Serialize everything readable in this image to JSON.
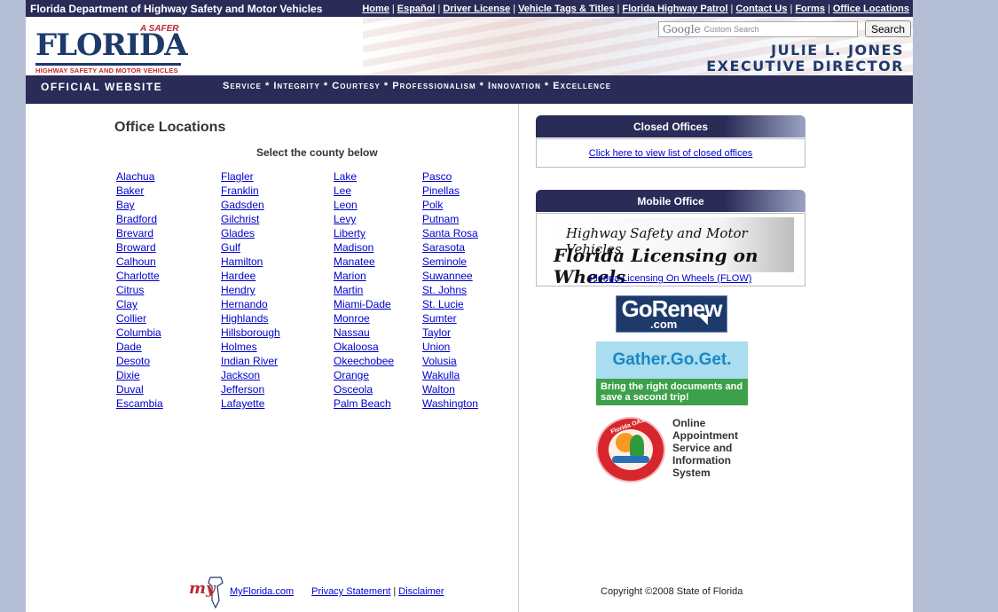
{
  "topbar": {
    "site_name": "Florida Department of Highway Safety and Motor Vehicles",
    "nav": [
      "Home",
      "Español",
      "Driver License",
      "Vehicle Tags & Titles",
      "Florida Highway Patrol",
      "Contact Us",
      "Forms",
      "Office Locations"
    ]
  },
  "banner": {
    "logo_safer": "A SAFER",
    "logo_florida": "FLORIDA",
    "logo_tagline": "HIGHWAY SAFETY AND MOTOR VEHICLES",
    "search_brand": "Google",
    "search_placeholder": "Custom Search",
    "search_button": "Search",
    "director_name": "JULIE L. JONES",
    "director_title": "EXECUTIVE DIRECTOR"
  },
  "valuesbar": {
    "official": "OFFICIAL WEBSITE",
    "values": "Service * Integrity * Courtesy * Professionalism * Innovation * Excellence"
  },
  "main": {
    "heading": "Office Locations",
    "select_prompt": "Select the county below",
    "counties_col1": [
      "Alachua",
      "Baker",
      "Bay",
      "Bradford",
      "Brevard",
      "Broward",
      "Calhoun",
      "Charlotte",
      "Citrus",
      "Clay",
      "Collier",
      "Columbia",
      "Dade",
      "Desoto",
      "Dixie",
      "Duval",
      "Escambia"
    ],
    "counties_col2": [
      "Flagler",
      "Franklin",
      "Gadsden",
      "Gilchrist",
      "Glades",
      "Gulf",
      "Hamilton",
      "Hardee",
      "Hendry",
      "Hernando",
      "Highlands",
      "Hillsborough",
      "Holmes",
      "Indian River",
      "Jackson",
      "Jefferson",
      "Lafayette"
    ],
    "counties_col3": [
      "Lake",
      "Lee",
      "Leon",
      "Levy",
      "Liberty",
      "Madison",
      "Manatee",
      "Marion",
      "Martin",
      "Miami-Dade",
      "Monroe",
      "Nassau",
      "Okaloosa",
      "Okeechobee",
      "Orange",
      "Osceola",
      "Palm Beach"
    ],
    "counties_col4": [
      "Pasco",
      "Pinellas",
      "Polk",
      "Putnam",
      "Santa Rosa",
      "Sarasota",
      "Seminole",
      "Suwannee",
      "St. Johns",
      "St. Lucie",
      "Sumter",
      "Taylor",
      "Union",
      "Volusia",
      "Wakulla",
      "Walton",
      "Washington"
    ]
  },
  "footer": {
    "myflorida_logo": "my",
    "myflorida_link": "MyFlorida.com",
    "privacy_link": "Privacy Statement",
    "separator": "|",
    "disclaimer_link": "Disclaimer",
    "copyright": "Copyright ©2008 State of Florida"
  },
  "sidebar": {
    "closed_title": "Closed Offices",
    "closed_link": "Click here to view list of closed offices",
    "mobile_title": "Mobile Office",
    "flow_line1": "Highway Safety and Motor Vehicles",
    "flow_line2": "Florida Licensing on Wheels",
    "flow_link": "Florida Licensing On Wheels (FLOW)",
    "gorenew_big": "GoRenew",
    "gorenew_com": ".com",
    "gather_title": "Gather.Go.Get.",
    "gather_sub": "Bring the right documents and save a second trip!",
    "oasis_ring": "Florida OASIS",
    "oasis_text": "Online Appointment Service and Information System"
  }
}
